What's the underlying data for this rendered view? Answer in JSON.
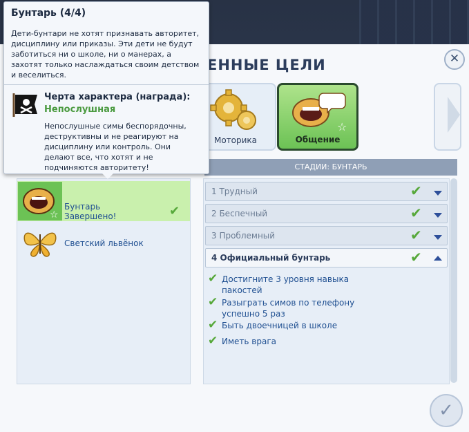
{
  "dialog": {
    "title": "ЕННЫЕ ЦЕЛИ",
    "close_label": "✕",
    "confirm_label": "✓"
  },
  "tiles": [
    {
      "label": "Моторика",
      "icon": "gears-icon"
    },
    {
      "label": "Общение",
      "icon": "mouth-speech-icon",
      "selected": true
    }
  ],
  "stages_header": "СТАДИИ: БУНТАРЬ",
  "left_list": [
    {
      "name": "Бунтарь",
      "status": "Завершено!",
      "done": true,
      "icon": "mouth-icon"
    },
    {
      "name": "Светский львёнок",
      "done": false,
      "icon": "butterfly-icon"
    }
  ],
  "stages": [
    {
      "label": "1 Трудный",
      "completed": true
    },
    {
      "label": "2 Беспечный",
      "completed": true
    },
    {
      "label": "3 Проблемный",
      "completed": true
    },
    {
      "label": "4 Официальный бунтарь",
      "completed": true,
      "expanded": true
    }
  ],
  "goals": [
    "Достигните 3 уровня навыка пакостей",
    "Разыграть симов по телефону успешно 5 раз",
    "Быть двоечницей в школе",
    "Иметь врага"
  ],
  "tooltip": {
    "title": "Бунтарь (4/4)",
    "description": "Дети-бунтари не хотят признавать авторитет, дисциплину или приказы. Эти дети не будут заботиться ни о школе, ни о манерах, а захотят только наслаждаться своим детством и веселиться.",
    "reward_title": "Черта характера (награда):",
    "reward_value": "Непослушная",
    "reward_description": "Непослушные симы беспорядочны, деструктивны и не реагируют на дисциплину или контроль. Они делают все, что хотят и не подчиняются авторитету!"
  },
  "colors": {
    "accent_green": "#56a83a",
    "selected_tile": "#6cc255",
    "text_blue": "#1f4f91"
  }
}
